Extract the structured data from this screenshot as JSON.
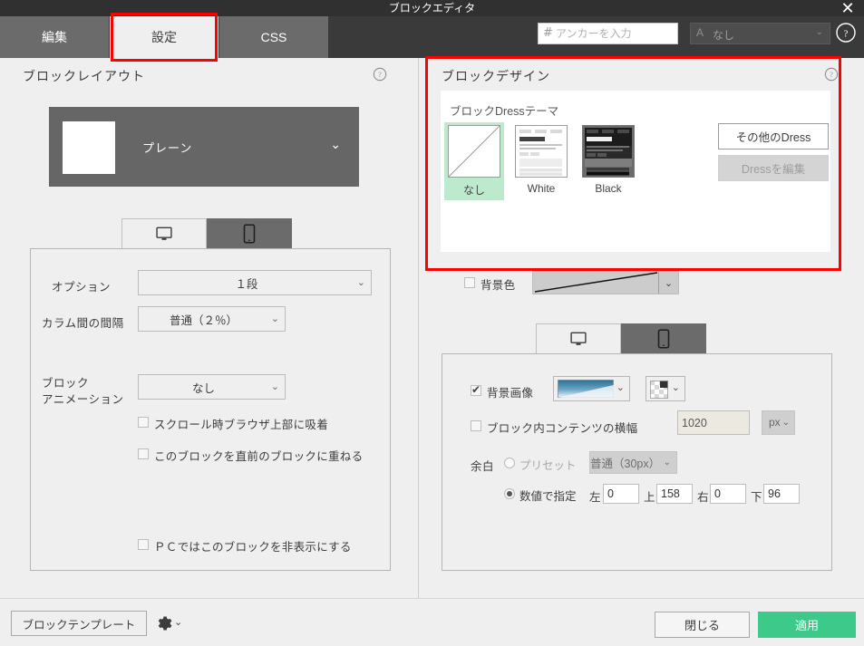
{
  "window": {
    "title": "ブロックエディタ",
    "close_icon": "close-icon"
  },
  "tabs": [
    {
      "label": "編集",
      "active": false
    },
    {
      "label": "設定",
      "active": true
    },
    {
      "label": "CSS",
      "active": false
    }
  ],
  "toolbar": {
    "anchor_prefix": "#",
    "anchor_placeholder": "アンカーを入力",
    "anchor_value": "",
    "font_glyph": "A",
    "font_value": "なし",
    "help_icon": "help-circle-icon"
  },
  "left_panel": {
    "title": "ブロックレイアウト",
    "help_icon": "help-circle-icon",
    "layout_preview": {
      "label": "プレーン",
      "caret": "⌄"
    },
    "device_tabs": [
      {
        "icon": "desktop-icon",
        "active": true
      },
      {
        "icon": "mobile-icon",
        "active": false
      }
    ],
    "rows": {
      "option_label": "オプション",
      "option_value": "１段",
      "column_gap_label": "カラム間の間隔",
      "column_gap_value": "普通（２％）",
      "animation_label_line1": "ブロック",
      "animation_label_line2": "アニメーション",
      "animation_value": "なし"
    },
    "checkboxes": [
      {
        "label": "スクロール時ブラウザ上部に吸着",
        "checked": false
      },
      {
        "label": "このブロックを直前のブロックに重ねる",
        "checked": false
      },
      {
        "label": "ＰＣではこのブロックを非表示にする",
        "checked": false
      }
    ]
  },
  "right_panel": {
    "title": "ブロックデザイン",
    "help_icon": "help-circle-icon",
    "dress": {
      "title": "ブロックDressテーマ",
      "items": [
        {
          "name": "なし",
          "type": "none",
          "selected": true
        },
        {
          "name": "White",
          "type": "white",
          "selected": false
        },
        {
          "name": "Black",
          "type": "black",
          "selected": false
        }
      ],
      "other_button": "その他のDress",
      "edit_button": "Dressを編集",
      "edit_disabled": true
    },
    "bg_color": {
      "label": "背景色",
      "checked": false,
      "swatch": "none-diagonal"
    },
    "device_tabs": [
      {
        "icon": "desktop-icon",
        "active": true
      },
      {
        "icon": "mobile-icon",
        "active": false
      }
    ],
    "bg_image": {
      "label": "背景画像",
      "checked": true,
      "preview": "blue-gradient",
      "overlay_preview": "checker-pattern"
    },
    "content_width": {
      "label": "ブロック内コンテンツの横幅",
      "checked": false,
      "value": "1020",
      "unit": "px"
    },
    "margin": {
      "label": "余白",
      "preset_label": "プリセット",
      "preset_selected": false,
      "preset_value": "普通（30px）",
      "numeric_label": "数値で指定",
      "numeric_selected": true,
      "fields": [
        {
          "label": "左",
          "value": "0"
        },
        {
          "label": "上",
          "value": "158"
        },
        {
          "label": "右",
          "value": "0"
        },
        {
          "label": "下",
          "value": "96"
        }
      ]
    }
  },
  "footer": {
    "template_button": "ブロックテンプレート",
    "gear_icon": "gear-icon",
    "gear_caret": "⌄",
    "close_button": "閉じる",
    "apply_button": "適用",
    "apply_color": "#3dc98a"
  }
}
